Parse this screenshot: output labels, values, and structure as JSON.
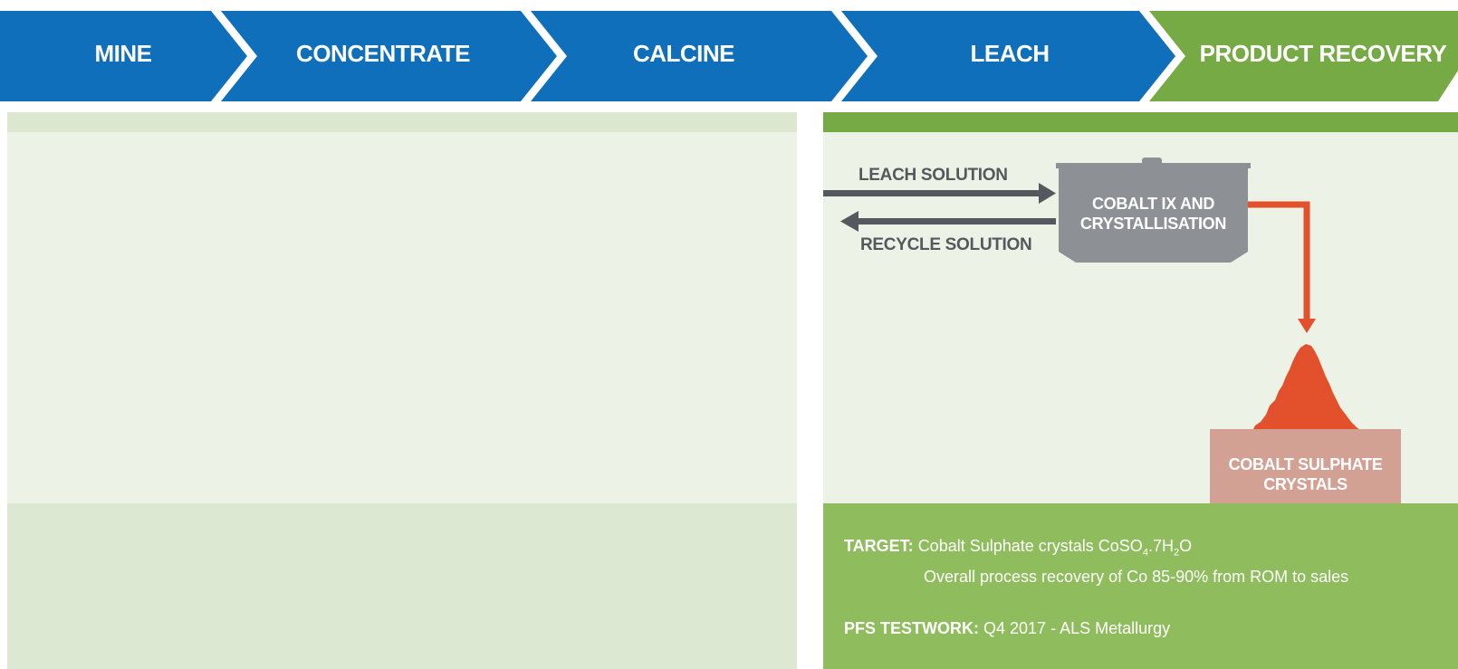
{
  "steps": [
    {
      "label": "MINE",
      "active": false
    },
    {
      "label": "CONCENTRATE",
      "active": false
    },
    {
      "label": "CALCINE",
      "active": false
    },
    {
      "label": "LEACH",
      "active": false
    },
    {
      "label": "PRODUCT RECOVERY",
      "active": true
    }
  ],
  "colors": {
    "step_blue": "#0f6fba",
    "step_green": "#75aa45",
    "panel_light": "#edf2e7",
    "panel_green": "#8fbc5c",
    "vessel_gray": "#8d9195",
    "flow_orange": "#e2512b",
    "crystal_box": "#d3a193",
    "arrow_gray": "#55585c"
  },
  "diagram": {
    "leach_solution": "LEACH SOLUTION",
    "recycle_solution": "RECYCLE SOLUTION",
    "vessel_line1": "COBALT IX AND",
    "vessel_line2": "CRYSTALLISATION",
    "product_line1": "COBALT SULPHATE",
    "product_line2": "CRYSTALS"
  },
  "info": {
    "target_key": "TARGET:",
    "target_value_prefix": "Cobalt Sulphate crystals CoSO",
    "sub_4": "4",
    "target_value_mid": ".7H",
    "sub_2": "2",
    "target_value_suffix": "O",
    "target_line2": "Overall process recovery of Co 85-90% from ROM to sales",
    "pfs_key": "PFS TESTWORK:",
    "pfs_value": "Q4 2017 - ALS Metallurgy"
  }
}
